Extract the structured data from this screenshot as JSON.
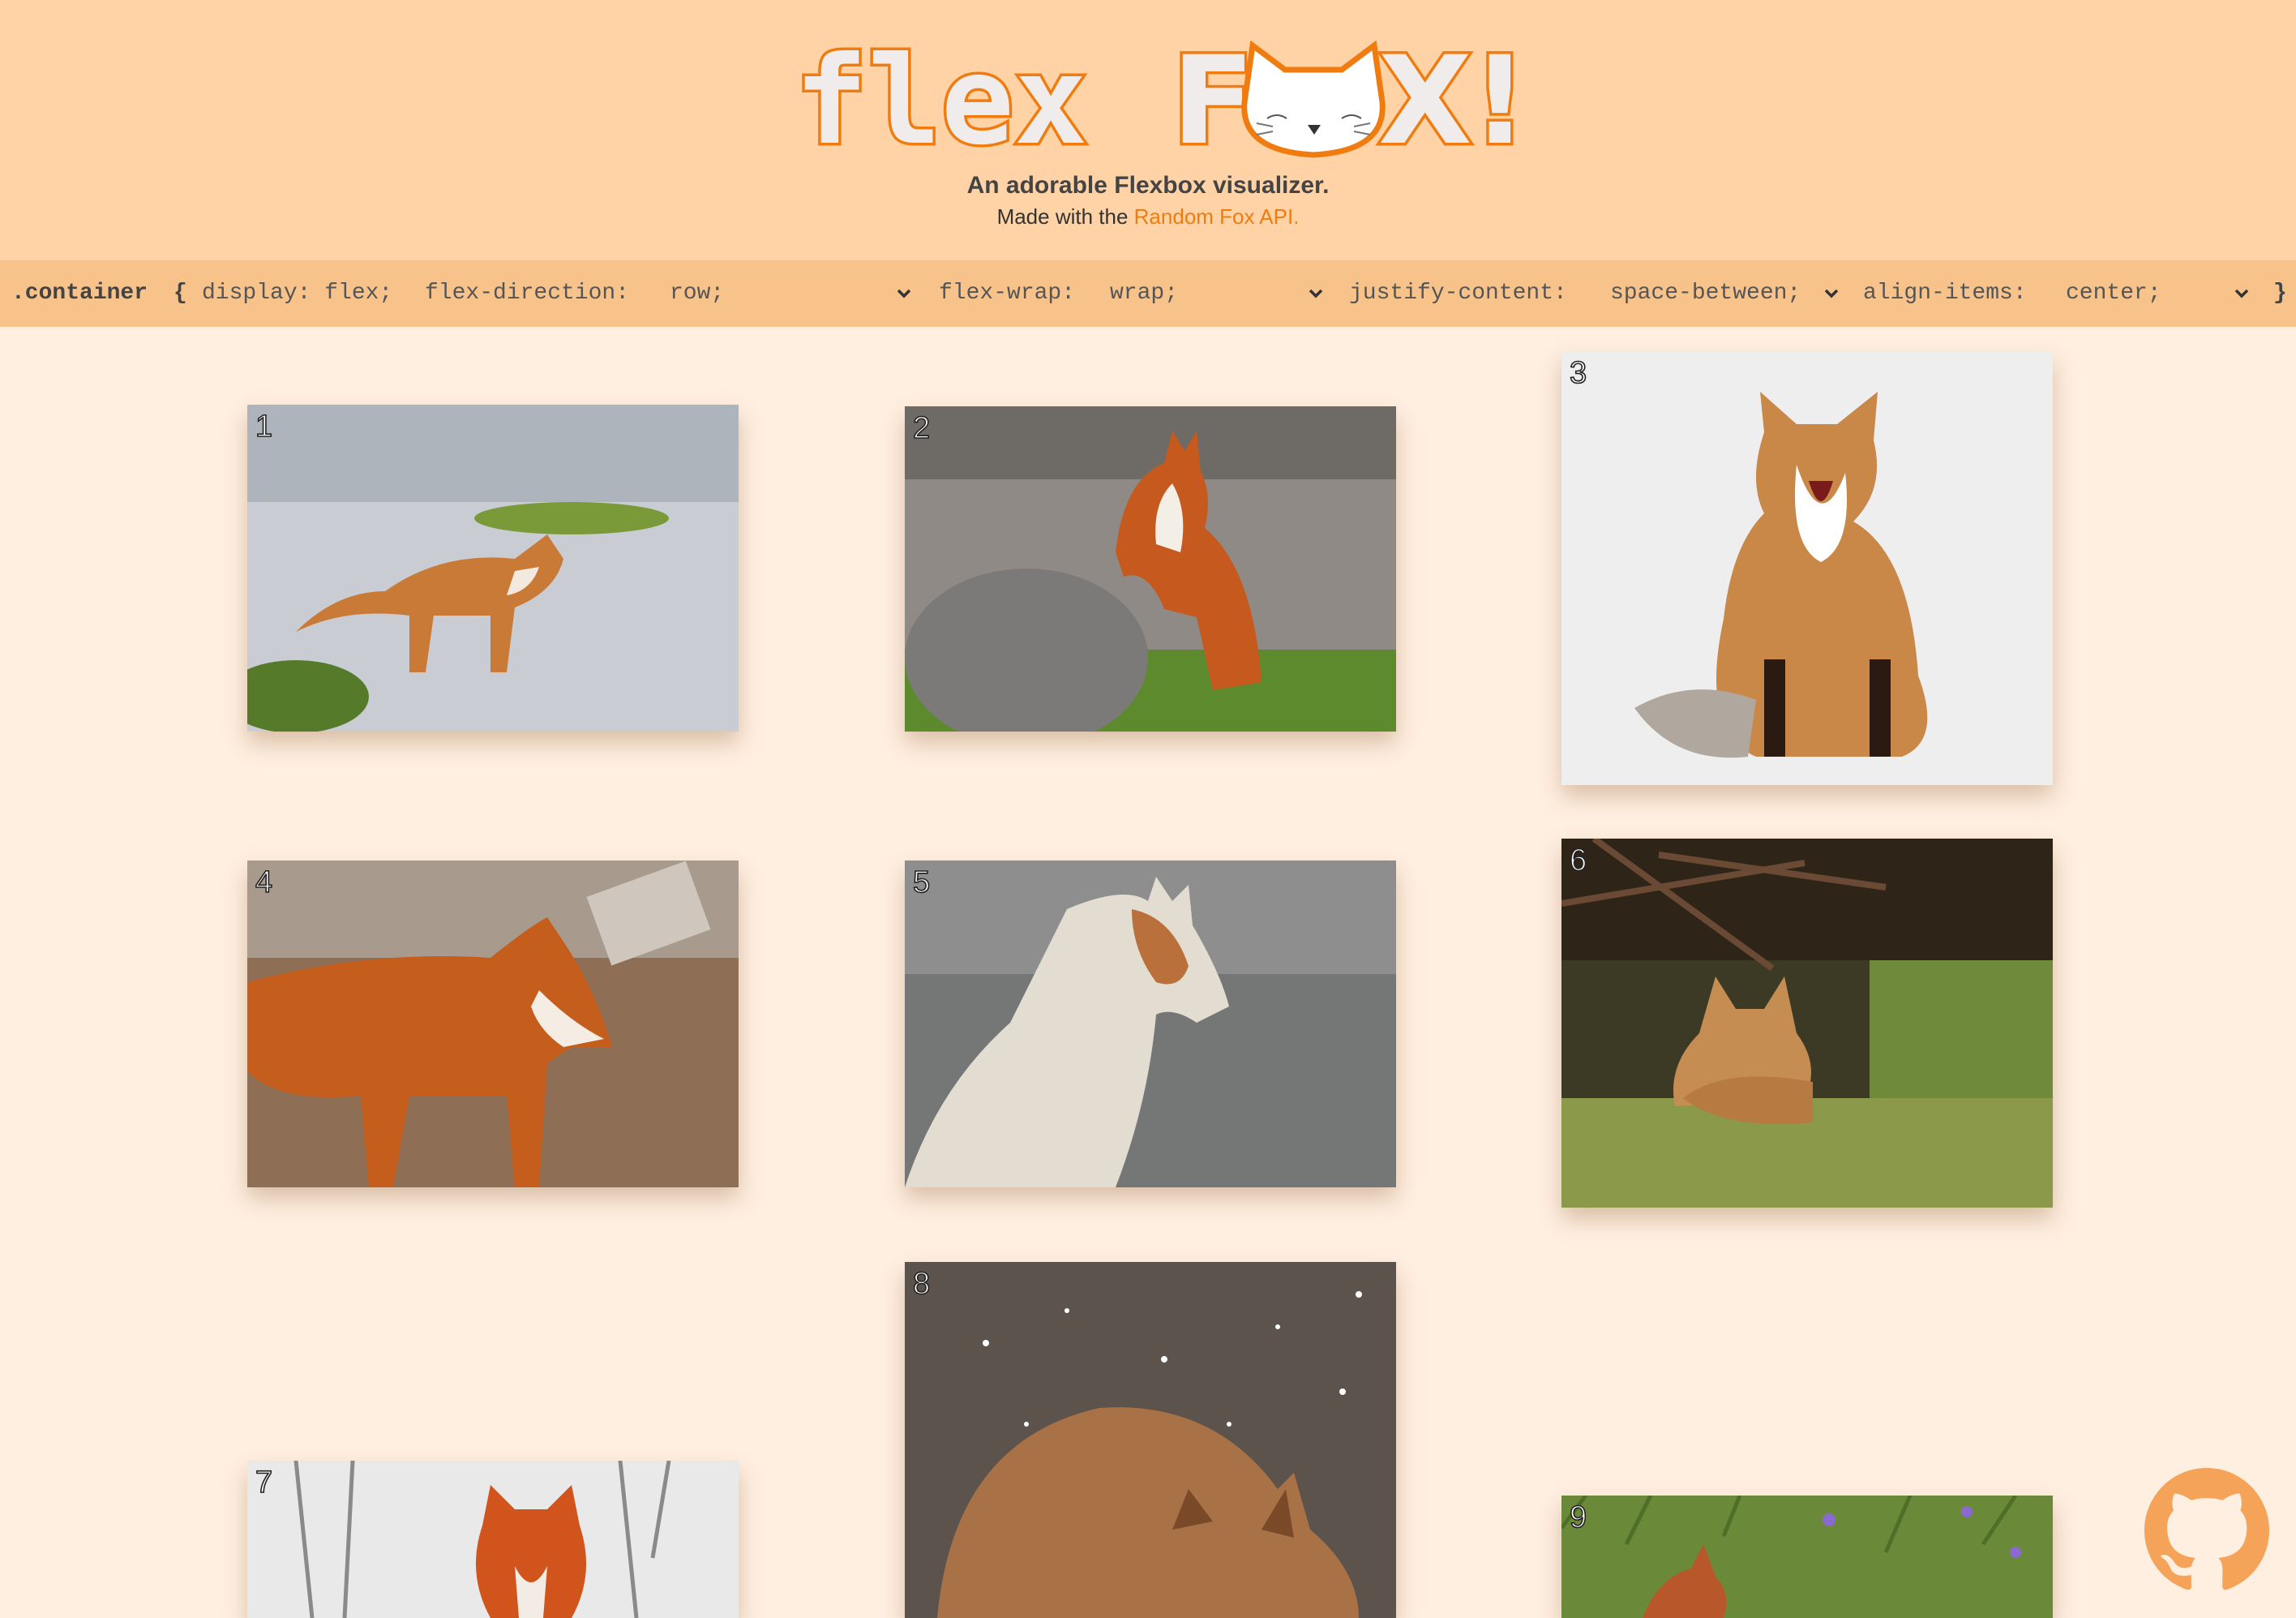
{
  "header": {
    "logo_text_left": "flex",
    "logo_text_right_1": "F",
    "logo_text_right_2": "X!",
    "tagline": "An adorable Flexbox visualizer.",
    "madewith_prefix": "Made with the ",
    "madewith_link": "Random Fox API."
  },
  "code": {
    "selector": ".container",
    "open_brace": "{",
    "display": "display: flex;",
    "flex_direction_label": "flex-direction:",
    "flex_direction_value": "row;",
    "flex_wrap_label": "flex-wrap:",
    "flex_wrap_value": "wrap;",
    "justify_content_label": "justify-content:",
    "justify_content_value": "space-between;",
    "align_items_label": "align-items:",
    "align_items_value": "center;",
    "close_brace": "}"
  },
  "cards": [
    {
      "number": "1",
      "scene": "fox walking on sand"
    },
    {
      "number": "2",
      "scene": "fox leaning on rock"
    },
    {
      "number": "3",
      "scene": "fox yawning in snow"
    },
    {
      "number": "4",
      "scene": "fox standing profile"
    },
    {
      "number": "5",
      "scene": "fox sitting on gravel"
    },
    {
      "number": "6",
      "scene": "fox resting near den"
    },
    {
      "number": "7",
      "scene": "fox among branches"
    },
    {
      "number": "8",
      "scene": "fox in falling snow"
    },
    {
      "number": "9",
      "scene": "fox in grass"
    }
  ],
  "colors": {
    "header_bg": "#ffd3a6",
    "codebar_bg": "#f8c38b",
    "page_bg": "#ffefe0",
    "accent": "#f07c10"
  },
  "icons": {
    "github": "github-icon",
    "chevron": "chevron-down-icon"
  }
}
